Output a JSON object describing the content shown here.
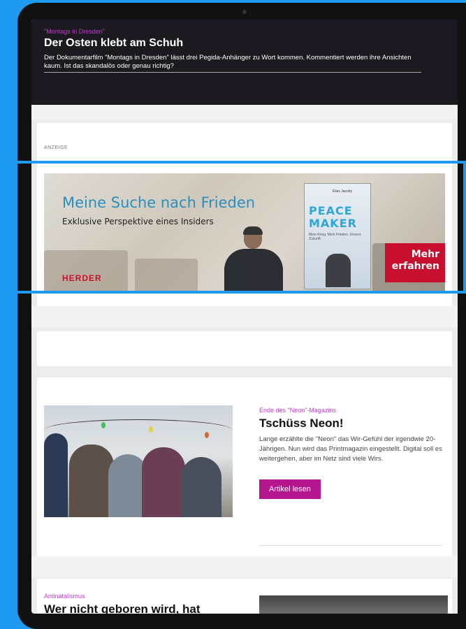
{
  "header": {
    "kicker": "\"Montags in Dresden\"",
    "title": "Der Osten klebt am Schuh",
    "teaser": "Der Dokumentarfilm \"Montags in Dresden\" lässt drei Pegida-Anhänger zu Wort kommen. Kommentiert werden ihre Ansichten kaum. Ist das skandalös oder genau richtig?"
  },
  "ad": {
    "label": "ANZEIGE",
    "headline": "Meine Suche nach Frieden",
    "subline": "Exklusive Perspektive eines Insiders",
    "brand": "HERDER",
    "book_title_line1": "PEACE",
    "book_title_line2": "MAKER",
    "book_author": "Elias Jacoby",
    "book_subtitle": "Mein Krieg. Mein Frieden. Unsere Zukunft.",
    "cta_line1": "Mehr",
    "cta_line2": "erfahren",
    "accent_color": "#2a8fbf",
    "cta_color": "#c8102e"
  },
  "article1": {
    "kicker": "Ende des \"Neon\"-Magazins",
    "title": "Tschüss Neon!",
    "body": "Lange erzählte die \"Neon\" das Wir-Gefühl der irgendwie 20-Jährigen. Nun wird das Printmagazin eingestellt. Digital soll es weitergehen, aber im Netz sind viele Wirs.",
    "button": "Artikel lesen",
    "button_color": "#b5168e"
  },
  "article2": {
    "kicker": "Antinatalismus",
    "title": "Wer nicht geboren wird, hat"
  }
}
